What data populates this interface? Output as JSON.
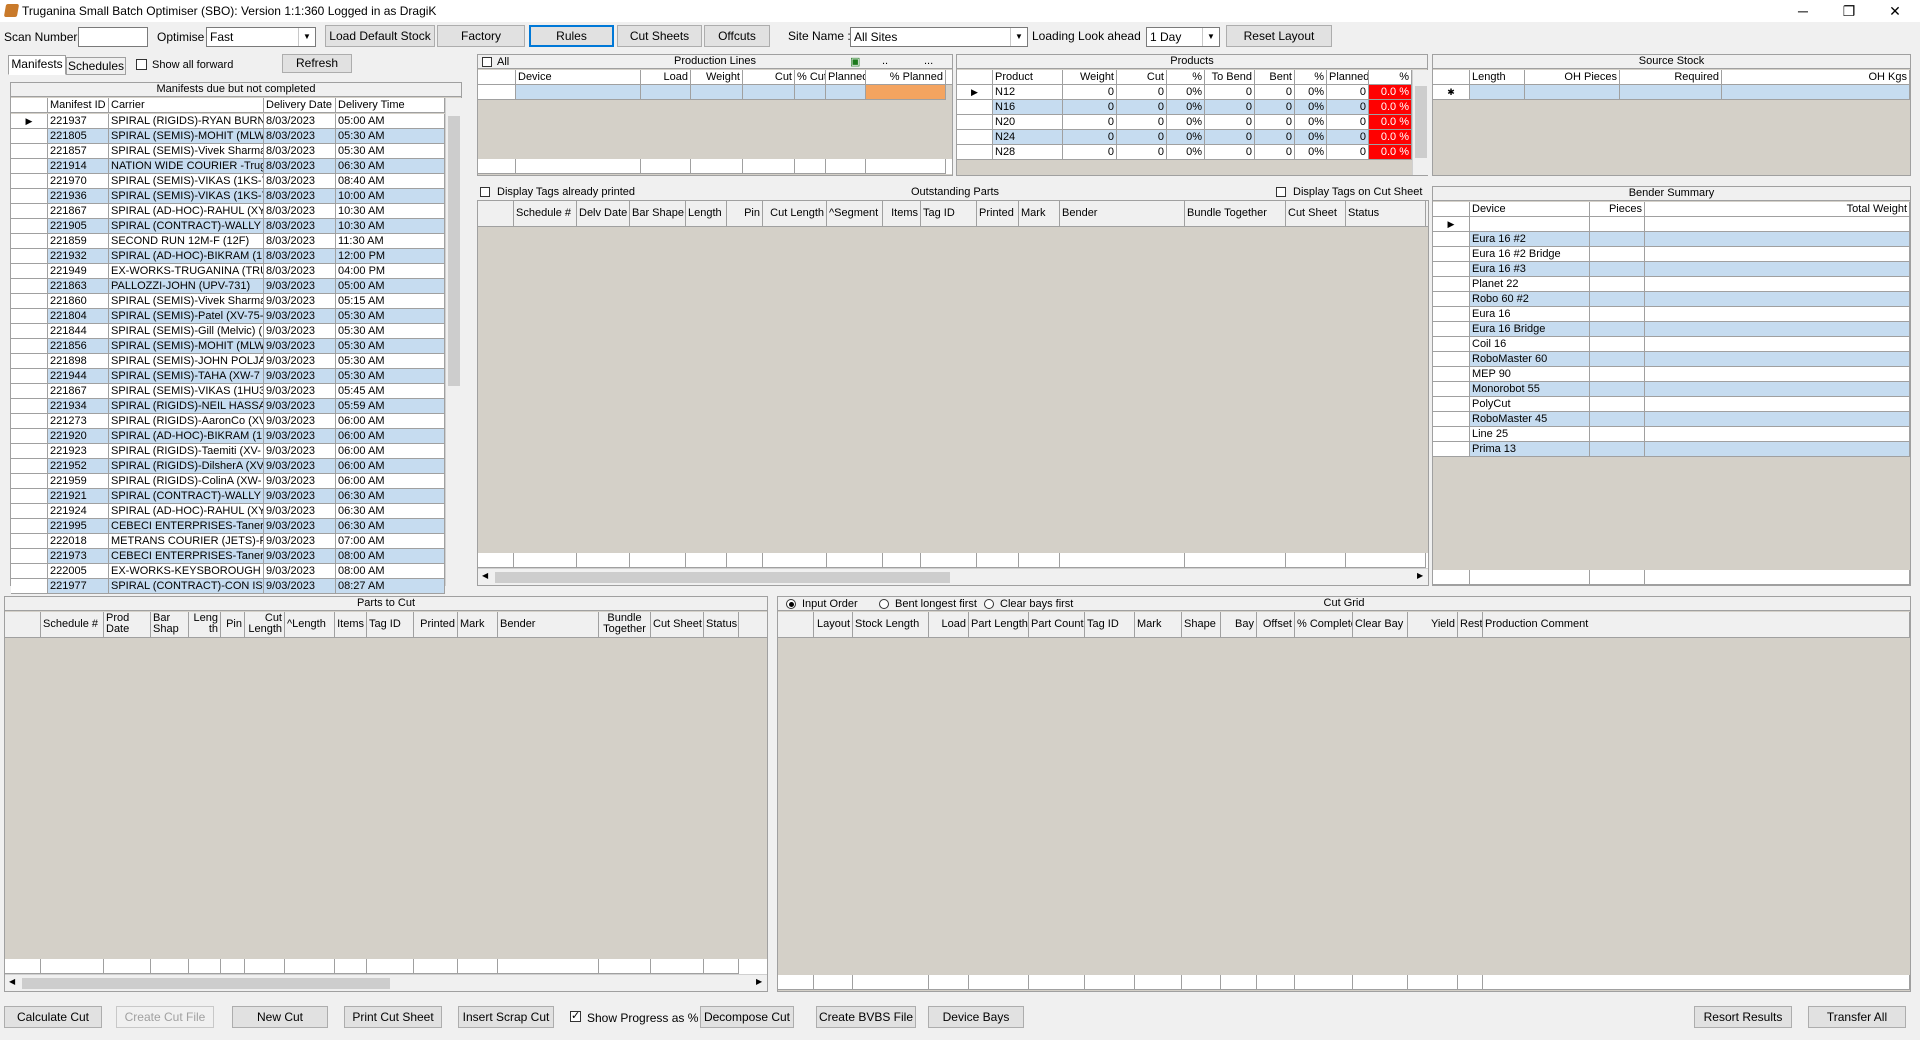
{
  "title": "Truganina Small Batch Optimiser (SBO): Version 1:1:360 Logged in as DragiK",
  "window": {
    "minimize": "─",
    "restore": "❐",
    "close": "✕"
  },
  "toolbar": {
    "scan_label": "Scan Number :",
    "scan_value": "",
    "optimise_label": "Optimise :",
    "optimise_value": "Fast",
    "load_default_stock": "Load Default Stock",
    "factory": "Factory",
    "rules": "Rules",
    "cut_sheets": "Cut Sheets",
    "offcuts": "Offcuts",
    "site_label": "Site Name :",
    "site_value": "All Sites",
    "lookahead_label": "Loading Look ahead",
    "lookahead_value": "1 Day",
    "reset_layout": "Reset Layout"
  },
  "left": {
    "tab_manifests": "Manifests",
    "tab_schedules": "Schedules",
    "show_all_forward": "Show all forward",
    "refresh": "Refresh",
    "panel_title": "Manifests due but not completed",
    "headers": [
      "Manifest ID",
      "Carrier",
      "Delivery Date",
      "Delivery Time"
    ],
    "rows": [
      [
        "221937",
        "SPIRAL (RIGIDS)-RYAN BURN",
        "8/03/2023",
        "05:00 AM"
      ],
      [
        "221805",
        "SPIRAL (SEMIS)-MOHIT (MLW",
        "8/03/2023",
        "05:30 AM"
      ],
      [
        "221857",
        "SPIRAL (SEMIS)-Vivek Sharma",
        "8/03/2023",
        "05:30 AM"
      ],
      [
        "221914",
        "NATION WIDE COURIER -Trug",
        "8/03/2023",
        "06:30 AM"
      ],
      [
        "221970",
        "SPIRAL (SEMIS)-VIKAS (1KS-7",
        "8/03/2023",
        "08:40 AM"
      ],
      [
        "221936",
        "SPIRAL (SEMIS)-VIKAS (1KS-7",
        "8/03/2023",
        "10:00 AM"
      ],
      [
        "221867",
        "SPIRAL (AD-HOC)-RAHUL (XY",
        "8/03/2023",
        "10:30 AM"
      ],
      [
        "221905",
        "SPIRAL (CONTRACT)-WALLY",
        "8/03/2023",
        "10:30 AM"
      ],
      [
        "221859",
        "SECOND RUN 12M-F (12F)",
        "8/03/2023",
        "11:30 AM"
      ],
      [
        "221932",
        "SPIRAL (AD-HOC)-BIKRAM (1I",
        "8/03/2023",
        "12:00 PM"
      ],
      [
        "221949",
        "EX-WORKS-TRUGANINA (TRU",
        "8/03/2023",
        "04:00 PM"
      ],
      [
        "221863",
        "PALLOZZI-JOHN (UPV-731)",
        "9/03/2023",
        "05:00 AM"
      ],
      [
        "221860",
        "SPIRAL (SEMIS)-Vivek Sharma",
        "9/03/2023",
        "05:15 AM"
      ],
      [
        "221804",
        "SPIRAL (SEMIS)-Patel (XV-75-",
        "9/03/2023",
        "05:30 AM"
      ],
      [
        "221844",
        "SPIRAL (SEMIS)-Gill (Melvic) (",
        "9/03/2023",
        "05:30 AM"
      ],
      [
        "221856",
        "SPIRAL (SEMIS)-MOHIT (MLW",
        "9/03/2023",
        "05:30 AM"
      ],
      [
        "221898",
        "SPIRAL (SEMIS)-JOHN POLJA",
        "9/03/2023",
        "05:30 AM"
      ],
      [
        "221944",
        "SPIRAL (SEMIS)-TAHA (XW-7",
        "9/03/2023",
        "05:30 AM"
      ],
      [
        "221867",
        "SPIRAL (SEMIS)-VIKAS (1HU3",
        "9/03/2023",
        "05:45 AM"
      ],
      [
        "221934",
        "SPIRAL (RIGIDS)-NEIL HASSA",
        "9/03/2023",
        "05:59 AM"
      ],
      [
        "221273",
        "SPIRAL (RIGIDS)-AaronCo (XV",
        "9/03/2023",
        "06:00 AM"
      ],
      [
        "221920",
        "SPIRAL (AD-HOC)-BIKRAM (1I",
        "9/03/2023",
        "06:00 AM"
      ],
      [
        "221923",
        "SPIRAL (RIGIDS)-Taemiti (XV-",
        "9/03/2023",
        "06:00 AM"
      ],
      [
        "221952",
        "SPIRAL (RIGIDS)-DilsherA (XV",
        "9/03/2023",
        "06:00 AM"
      ],
      [
        "221959",
        "SPIRAL (RIGIDS)-ColinA (XW-",
        "9/03/2023",
        "06:00 AM"
      ],
      [
        "221921",
        "SPIRAL (CONTRACT)-WALLY",
        "9/03/2023",
        "06:30 AM"
      ],
      [
        "221924",
        "SPIRAL (AD-HOC)-RAHUL (XY",
        "9/03/2023",
        "06:30 AM"
      ],
      [
        "221995",
        "CEBECI ENTERPRISES-Taner",
        "9/03/2023",
        "06:30 AM"
      ],
      [
        "222018",
        "METRANS COURIER (JETS)-P",
        "9/03/2023",
        "07:00 AM"
      ],
      [
        "221973",
        "CEBECI ENTERPRISES-Taner",
        "9/03/2023",
        "08:00 AM"
      ],
      [
        "222005",
        "EX-WORKS-KEYSBOROUGH (",
        "9/03/2023",
        "08:00 AM"
      ],
      [
        "221977",
        "SPIRAL (CONTRACT)-CON IS",
        "9/03/2023",
        "08:27 AM"
      ]
    ]
  },
  "production": {
    "all_label": "All",
    "title": "Production Lines",
    "btn1": "..",
    "btn2": "...",
    "headers": [
      "Device",
      "Load",
      "Weight",
      "Cut",
      "% Cut",
      "Planned",
      "% Planned"
    ]
  },
  "products": {
    "title": "Products",
    "headers": [
      "Product",
      "Weight",
      "Cut",
      "%",
      "To Bend",
      "Bent",
      "%",
      "Planned",
      "%"
    ],
    "rows": [
      [
        "N12",
        "0",
        "0",
        "0%",
        "0",
        "0",
        "0%",
        "0",
        "0.0 %"
      ],
      [
        "N16",
        "0",
        "0",
        "0%",
        "0",
        "0",
        "0%",
        "0",
        "0.0 %"
      ],
      [
        "N20",
        "0",
        "0",
        "0%",
        "0",
        "0",
        "0%",
        "0",
        "0.0 %"
      ],
      [
        "N24",
        "0",
        "0",
        "0%",
        "0",
        "0",
        "0%",
        "0",
        "0.0 %"
      ],
      [
        "N28",
        "0",
        "0",
        "0%",
        "0",
        "0",
        "0%",
        "0",
        "0.0 %"
      ]
    ]
  },
  "source": {
    "title": "Source Stock",
    "headers": [
      "Length",
      "OH Pieces",
      "Required",
      "OH Kgs"
    ],
    "newrow": "✱"
  },
  "outstanding": {
    "display_printed": "Display Tags already printed",
    "title": "Outstanding Parts",
    "display_cut": "Display Tags on Cut Sheet",
    "headers": [
      "Schedule #",
      "Delv Date",
      "Bar Shape",
      "Length",
      "Pin",
      "Cut Length",
      "^Segment",
      "Items",
      "Tag ID",
      "Printed",
      "Mark",
      "Bender",
      "Bundle Together",
      "Cut Sheet",
      "Status"
    ]
  },
  "bender": {
    "title": "Bender Summary",
    "headers": [
      "Device",
      "Pieces",
      "Total Weight"
    ],
    "rows": [
      "Eura 16 #2",
      "Eura 16 #2 Bridge",
      "Eura 16 #3",
      "Planet 22",
      "Robo 60 #2",
      "Eura 16",
      "Eura 16 Bridge",
      "Coil 16",
      "RoboMaster 60",
      "MEP 90",
      "Monorobot 55",
      "PolyCut",
      "RoboMaster 45",
      "Line 25",
      "Prima 13"
    ]
  },
  "parts": {
    "title": "Parts to Cut",
    "headers": [
      "Schedule #",
      "Prod Date",
      "Bar Shap",
      "Length",
      "Pin",
      "Cut Length",
      "^Length",
      "Items",
      "Tag ID",
      "Printed",
      "Mark",
      "Bender",
      "Bundle Together",
      "Cut Sheet",
      "Status"
    ]
  },
  "cutgrid": {
    "title": "Cut Grid",
    "radio1": "Input Order",
    "radio2": "Bent longest first",
    "radio3": "Clear bays first",
    "headers": [
      "Layout",
      "Stock Length",
      "Load",
      "Part Length",
      "Part Count",
      "Tag ID",
      "Mark",
      "Shape",
      "Bay",
      "Offset",
      "% Complete",
      "Clear Bay",
      "Yield",
      "Rest",
      "Production Comment"
    ]
  },
  "bottom": {
    "calculate": "Calculate Cut",
    "create_file": "Create Cut File",
    "new_cut": "New Cut",
    "print": "Print Cut Sheet",
    "insert_scrap": "Insert Scrap Cut",
    "show_progress": "Show Progress as %",
    "decompose": "Decompose Cut",
    "bvbs": "Create BVBS File",
    "device_bays": "Device Bays",
    "resort": "Resort Results",
    "transfer": "Transfer All"
  }
}
